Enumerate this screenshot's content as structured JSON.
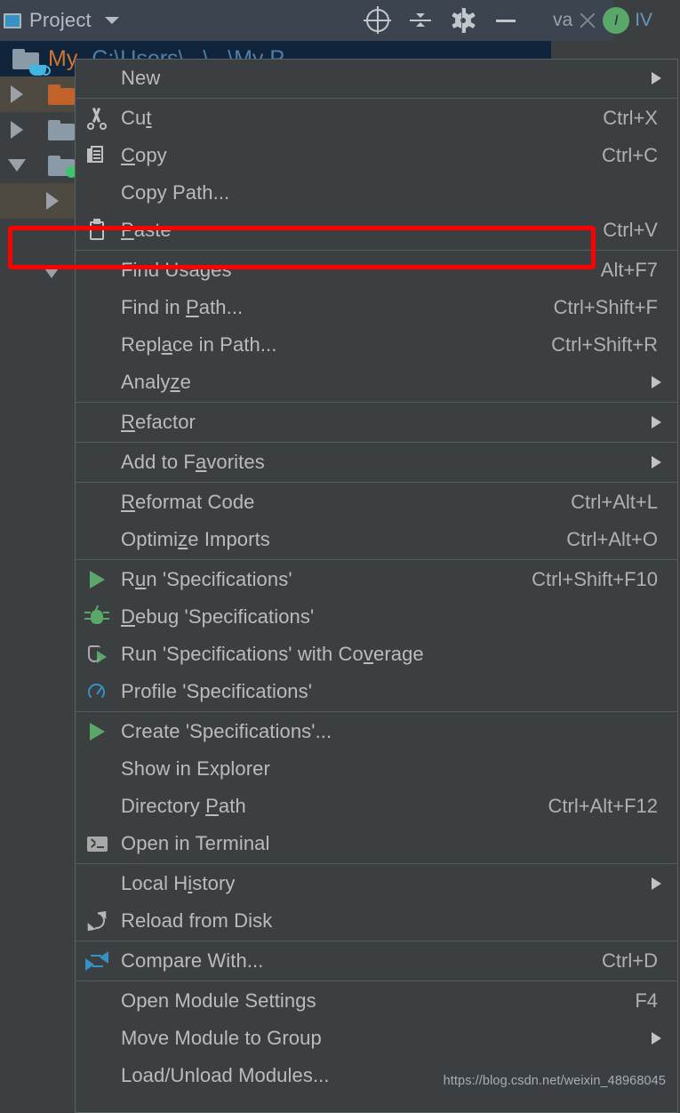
{
  "toolbar": {
    "panel_title": "Project",
    "caret_icon": "chevron-down-icon",
    "icons": [
      "locate-target-icon",
      "collapse-all-icon",
      "settings-gear-icon",
      "minimize-icon"
    ],
    "tab_label": "va",
    "close_label": "×",
    "avatar_initial": "I",
    "edge_text": "IV"
  },
  "tree": {
    "root_label": "My",
    "root_path": "C:\\Users\\...\\...\\My P...",
    "rows": [
      {
        "name": "project-root-row",
        "arrow": "none",
        "folder": "folder-java-icon"
      },
      {
        "name": "tree-row-1",
        "arrow": "right",
        "folder": "folder-orange-icon"
      },
      {
        "name": "tree-row-2",
        "arrow": "right",
        "folder": "folder-gray-icon"
      },
      {
        "name": "tree-row-3",
        "arrow": "down",
        "folder": "folder-gray-source-icon"
      },
      {
        "name": "tree-row-4",
        "arrow": "right",
        "folder": "none"
      },
      {
        "name": "tree-row-5",
        "arrow": "none",
        "folder": "none"
      },
      {
        "name": "tree-row-6",
        "arrow": "down",
        "folder": "none"
      }
    ]
  },
  "context_menu": {
    "highlighted_item": "Find in Path...",
    "highlight_color": "#fe0000",
    "groups": [
      {
        "items": [
          {
            "label": "New",
            "mnemonic": "",
            "accel": "",
            "submenu": true,
            "icon": "none"
          }
        ]
      },
      {
        "items": [
          {
            "label": "Cut",
            "mnemonic": "t",
            "accel": "Ctrl+X",
            "submenu": false,
            "icon": "cut-icon"
          },
          {
            "label": "Copy",
            "mnemonic": "C",
            "accel": "Ctrl+C",
            "submenu": false,
            "icon": "copy-icon"
          },
          {
            "label": "Copy Path...",
            "mnemonic": "",
            "accel": "",
            "submenu": false,
            "icon": "none"
          },
          {
            "label": "Paste",
            "mnemonic": "P",
            "accel": "Ctrl+V",
            "submenu": false,
            "icon": "paste-icon"
          }
        ]
      },
      {
        "items": [
          {
            "label": "Find Usages",
            "mnemonic": "",
            "accel": "Alt+F7",
            "submenu": false,
            "icon": "none"
          },
          {
            "label": "Find in Path...",
            "mnemonic": "P",
            "accel": "Ctrl+Shift+F",
            "submenu": false,
            "icon": "none"
          },
          {
            "label": "Replace in Path...",
            "mnemonic": "a",
            "accel": "Ctrl+Shift+R",
            "submenu": false,
            "icon": "none"
          },
          {
            "label": "Analyze",
            "mnemonic": "z",
            "accel": "",
            "submenu": true,
            "icon": "none"
          }
        ]
      },
      {
        "items": [
          {
            "label": "Refactor",
            "mnemonic": "R",
            "accel": "",
            "submenu": true,
            "icon": "none"
          }
        ]
      },
      {
        "items": [
          {
            "label": "Add to Favorites",
            "mnemonic": "a",
            "accel": "",
            "submenu": true,
            "icon": "none"
          }
        ]
      },
      {
        "items": [
          {
            "label": "Reformat Code",
            "mnemonic": "R",
            "accel": "Ctrl+Alt+L",
            "submenu": false,
            "icon": "none"
          },
          {
            "label": "Optimize Imports",
            "mnemonic": "z",
            "accel": "Ctrl+Alt+O",
            "submenu": false,
            "icon": "none"
          }
        ]
      },
      {
        "items": [
          {
            "label": "Run 'Specifications'",
            "mnemonic": "u",
            "accel": "Ctrl+Shift+F10",
            "submenu": false,
            "icon": "run-icon"
          },
          {
            "label": "Debug 'Specifications'",
            "mnemonic": "D",
            "accel": "",
            "submenu": false,
            "icon": "debug-icon"
          },
          {
            "label": "Run 'Specifications' with Coverage",
            "mnemonic": "v",
            "accel": "",
            "submenu": false,
            "icon": "coverage-icon"
          },
          {
            "label": "Profile 'Specifications'",
            "mnemonic": "",
            "accel": "",
            "submenu": false,
            "icon": "profile-icon"
          }
        ]
      },
      {
        "items": [
          {
            "label": "Create 'Specifications'...",
            "mnemonic": "",
            "accel": "",
            "submenu": false,
            "icon": "run-icon"
          },
          {
            "label": "Show in Explorer",
            "mnemonic": "",
            "accel": "",
            "submenu": false,
            "icon": "none"
          },
          {
            "label": "Directory Path",
            "mnemonic": "P",
            "accel": "Ctrl+Alt+F12",
            "submenu": false,
            "icon": "none"
          },
          {
            "label": "Open in Terminal",
            "mnemonic": "",
            "accel": "",
            "submenu": false,
            "icon": "terminal-icon"
          }
        ]
      },
      {
        "items": [
          {
            "label": "Local History",
            "mnemonic": "i",
            "accel": "",
            "submenu": true,
            "icon": "none"
          },
          {
            "label": "Reload from Disk",
            "mnemonic": "",
            "accel": "",
            "submenu": false,
            "icon": "reload-icon"
          }
        ]
      },
      {
        "items": [
          {
            "label": "Compare With...",
            "mnemonic": "",
            "accel": "Ctrl+D",
            "submenu": false,
            "icon": "compare-icon"
          }
        ]
      },
      {
        "items": [
          {
            "label": "Open Module Settings",
            "mnemonic": "",
            "accel": "F4",
            "submenu": false,
            "icon": "none"
          },
          {
            "label": "Move Module to Group",
            "mnemonic": "",
            "accel": "",
            "submenu": true,
            "icon": "none"
          },
          {
            "label": "Load/Unload Modules...",
            "mnemonic": "",
            "accel": "",
            "submenu": false,
            "icon": "none"
          }
        ]
      }
    ]
  },
  "watermark": "https://blog.csdn.net/weixin_48968045"
}
